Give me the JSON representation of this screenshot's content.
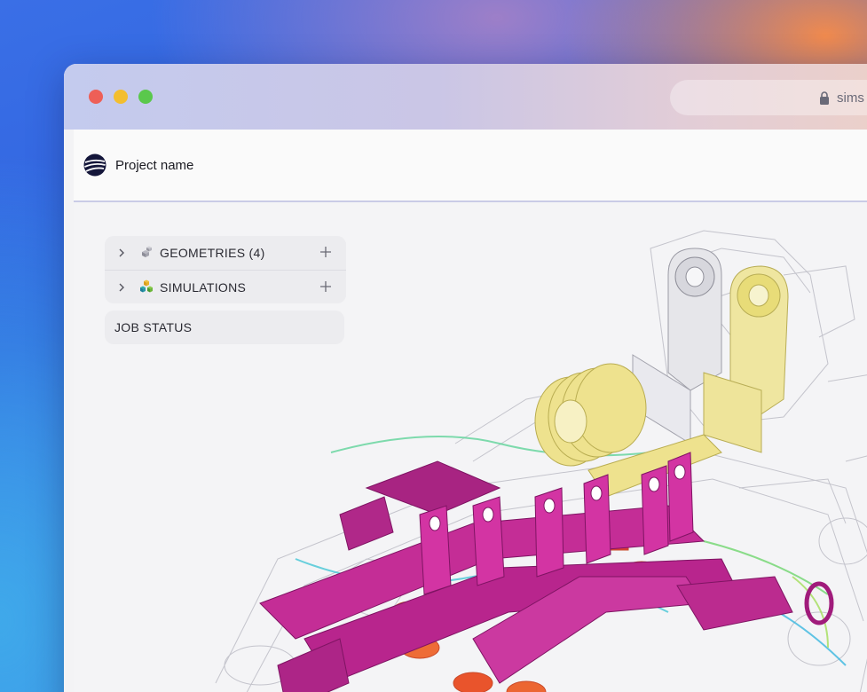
{
  "browser": {
    "url_partial": "sims"
  },
  "header": {
    "project_name": "Project name"
  },
  "sidebar": {
    "items": [
      {
        "label": "GEOMETRIES (4)",
        "icon": "geometry-cubes-icon"
      },
      {
        "label": "SIMULATIONS",
        "icon": "simulation-cubes-icon"
      }
    ],
    "job_status_label": "JOB STATUS"
  },
  "colors": {
    "accent_magenta": "#c0238f",
    "accent_yellow": "#eadf6a",
    "accent_orange": "#f0743c",
    "header_divider": "#c9cbe6"
  }
}
